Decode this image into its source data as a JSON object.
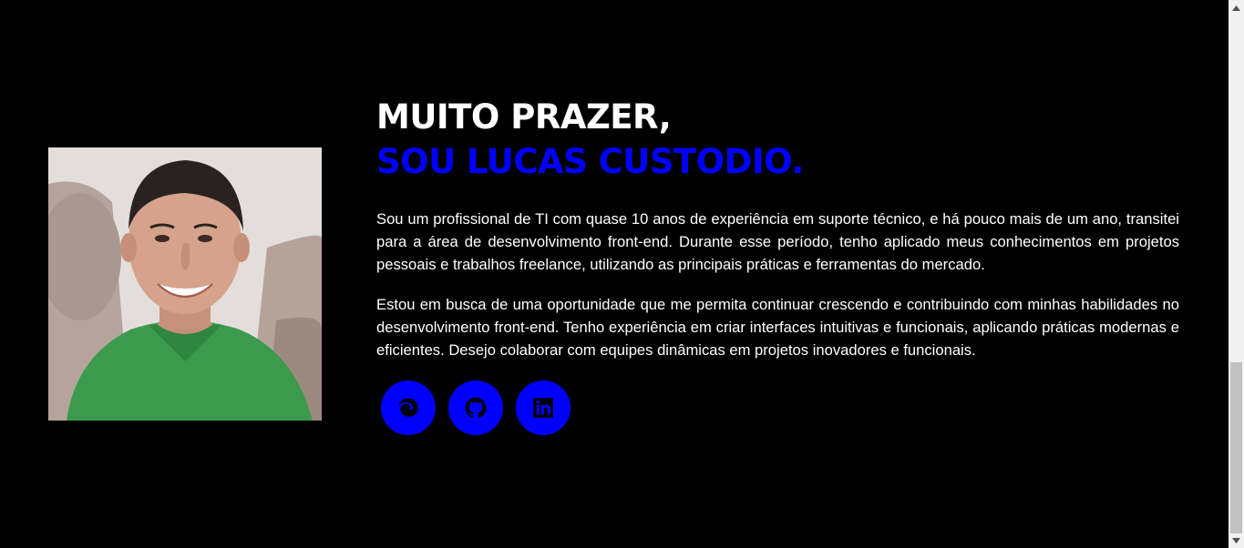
{
  "about": {
    "greeting": "MUITO PRAZER,",
    "name_line": "SOU LUCAS CUSTODIO.",
    "paragraph1": "Sou um profissional de TI com quase 10 anos de experiência em suporte técnico, e há pouco mais de um ano, transitei para a área de desenvolvimento front-end. Durante esse período, tenho aplicado meus conhecimentos em projetos pessoais e trabalhos freelance, utilizando as principais práticas e ferramentas do mercado.",
    "paragraph2": "Estou em busca de uma oportunidade que me permita continuar crescendo e contribuindo com minhas habilidades no desenvolvimento front-end. Tenho experiência em criar interfaces intuitivas e funcionais, aplicando práticas modernas e eficientes. Desejo colaborar com equipes dinâmicas em projetos inovadores e funcionais."
  },
  "social_links": [
    {
      "icon": "edge-browser-icon"
    },
    {
      "icon": "github-icon"
    },
    {
      "icon": "linkedin-icon"
    }
  ],
  "colors": {
    "background": "#000000",
    "accent": "#0000ff",
    "text": "#ffffff",
    "icon": "#000000"
  }
}
